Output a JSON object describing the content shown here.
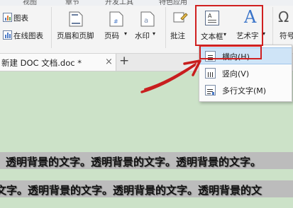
{
  "ribbon": {
    "tabs": [
      "视图",
      "章节",
      "开发工具",
      "特色应用"
    ],
    "chart_label": "图表",
    "online_chart_label": "在线图表",
    "header_footer_label": "页眉和页脚",
    "page_number_label": "页码",
    "watermark_label": "水印",
    "comment_label": "批注",
    "textbox_label": "文本框",
    "wordart_label": "艺术字",
    "symbol_label": "符号"
  },
  "document_tab": {
    "title": "新建 DOC 文档.doc *",
    "close_glyph": "×",
    "add_glyph": "+"
  },
  "textbox_menu": {
    "items": [
      {
        "label": "横向(H)",
        "icon": "horizontal-textbox-icon",
        "highlighted": true
      },
      {
        "label": "竖向(V)",
        "icon": "vertical-textbox-icon",
        "highlighted": false
      },
      {
        "label": "多行文字(M)",
        "icon": "multiline-text-icon",
        "highlighted": false
      }
    ]
  },
  "document": {
    "line1": "透明背景的文字。透明背景的文字。透明背景的文字。",
    "line2": "文字。透明背景的文字。透明背景的文字。透明背景的文"
  },
  "colors": {
    "annotation_red": "#d02020",
    "document_bg": "#cce2c8",
    "menu_highlight": "#cfe4f7"
  }
}
